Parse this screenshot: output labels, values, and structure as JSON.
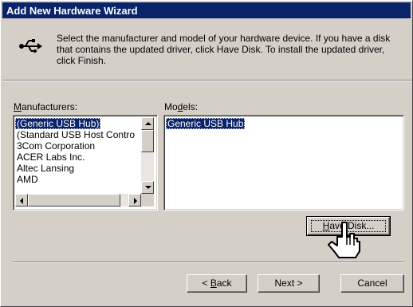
{
  "window": {
    "title": "Add New Hardware Wizard"
  },
  "header": {
    "icon": "usb-icon",
    "instructions": "Select the manufacturer and model of your hardware device. If you have a disk that contains the updated driver, click Have Disk. To install the updated driver, click Finish."
  },
  "manufacturers": {
    "label_accel": "M",
    "label_rest": "anufacturers:",
    "items": [
      "(Generic USB Hub)",
      "(Standard USB Host Contro",
      "3Com Corporation",
      "ACER Labs Inc.",
      "Altec Lansing",
      "AMD"
    ],
    "selected_index": 0
  },
  "models": {
    "label_pre": "Mo",
    "label_accel": "d",
    "label_post": "els:",
    "items": [
      "Generic USB Hub"
    ],
    "selected_index": 0
  },
  "buttons": {
    "have_disk_accel": "H",
    "have_disk_rest": "ave Disk...",
    "back_pre": "< ",
    "back_accel": "B",
    "back_post": "ack",
    "next": "Next >",
    "cancel": "Cancel"
  },
  "colors": {
    "selection": "#0a246a",
    "face": "#d4d0c8"
  }
}
